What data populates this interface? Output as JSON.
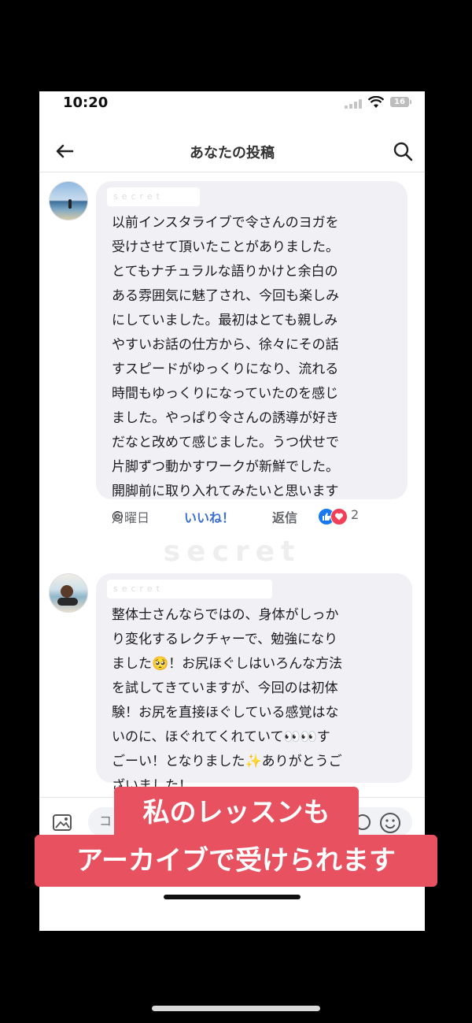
{
  "status": {
    "time": "10:20",
    "battery": "16"
  },
  "header": {
    "title": "あなたの投稿"
  },
  "comments": [
    {
      "name_mask": "secret",
      "text": "以前インスタライブで令さんのヨガを\n受けさせて頂いたことがありました。\nとてもナチュラルな語りかけと余白の\nある雰囲気に魅了され、今回も楽しみ\nにしていました。最初はとても親しみ\nやすいお話の仕方から、徐々にその話\nすスピードがゆっくりになり、流れる\n時間もゆっくりになっていたのを感じ\nました。やっぱり令さんの誘導が好き\nだなと改めて感じました。うつ伏せで\n片脚ずつ動かすワークが新鮮でした。\n開脚前に取り入れてみたいと思います\n◎",
      "day": "月曜日",
      "like_label": "いいね！",
      "reply_label": "返信",
      "reaction_count": "2"
    },
    {
      "name_mask": "secret",
      "text": "整体士さんならではの、身体がしっか\nり変化するレクチャーで、勉強になり\nました🥺！お尻ほぐしはいろんな方法\nを試してきていますが、今回のは初体\n験！お尻を直接ほぐしている感覚はな\nいのに、ほぐれてくれていて👀👀す\nごーい！となりました✨ありがとうご\nざいました！"
    }
  ],
  "watermark": "secret",
  "composer": {
    "placeholder": "コ"
  },
  "banners": {
    "line1": "私のレッスンも",
    "line2": "アーカイブで受けられます"
  },
  "colors": {
    "accent": "#e8515f",
    "like": "#3b6fd4",
    "bubble": "#f0f0f5"
  }
}
